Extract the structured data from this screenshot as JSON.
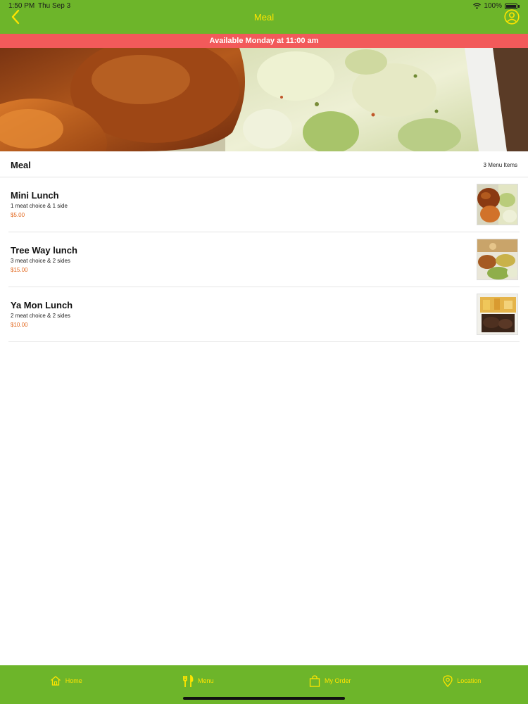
{
  "status_bar": {
    "time": "1:50 PM",
    "date": "Thu Sep 3",
    "battery": "100%"
  },
  "header": {
    "title": "Meal",
    "back_icon": "chevron-left-icon",
    "profile_icon": "user-circle-icon"
  },
  "banner": {
    "text": "Available Monday at 11:00 am"
  },
  "section": {
    "title": "Meal",
    "count": "3 Menu Items"
  },
  "menu_items": [
    {
      "name": "Mini Lunch",
      "description": "1 meat choice & 1 side",
      "price": "$5.00"
    },
    {
      "name": "Tree Way lunch",
      "description": "3 meat choice & 2 sides",
      "price": "$15.00"
    },
    {
      "name": "Ya Mon Lunch",
      "description": "2 meat choice & 2 sides",
      "price": "$10.00"
    }
  ],
  "tabbar": {
    "tabs": [
      {
        "label": "Home",
        "icon": "home-icon"
      },
      {
        "label": "Menu",
        "icon": "fork-knife-icon"
      },
      {
        "label": "My Order",
        "icon": "shopping-bag-icon"
      },
      {
        "label": "Location",
        "icon": "map-pin-icon"
      }
    ]
  },
  "colors": {
    "brand_green": "#6db52a",
    "accent_yellow": "#ffe400",
    "banner_red": "#f25a5a",
    "price_orange": "#e2661c"
  }
}
